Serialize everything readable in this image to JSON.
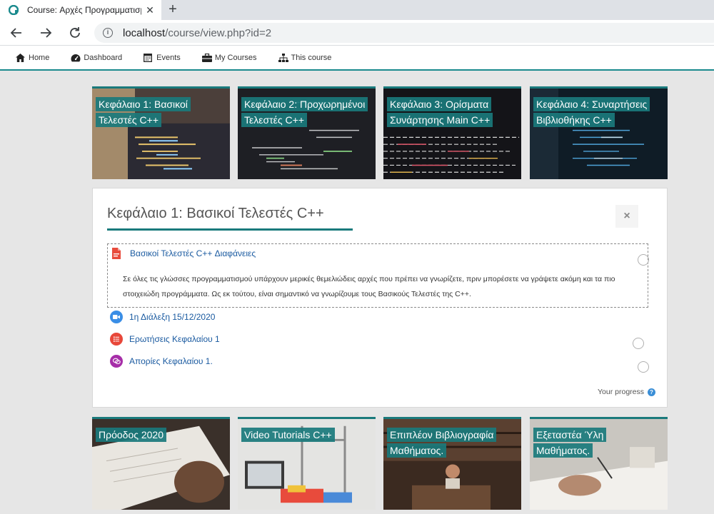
{
  "browser": {
    "tab_title": "Course: Αρχές Προγραμματισμο",
    "new_tab": "+",
    "url_host": "localhost",
    "url_path": "/course/view.php?id=2"
  },
  "navbar": {
    "items": [
      {
        "label": "Home",
        "icon": "home-icon"
      },
      {
        "label": "Dashboard",
        "icon": "dashboard-icon"
      },
      {
        "label": "Events",
        "icon": "calendar-icon"
      },
      {
        "label": "My Courses",
        "icon": "briefcase-icon"
      },
      {
        "label": "This course",
        "icon": "sitemap-icon"
      }
    ]
  },
  "tiles_top": [
    {
      "title": "Κεφάλαιο 1: Βασικοί Τελεστές C++"
    },
    {
      "title": "Κεφάλαιο 2: Προχωρημένοι Τελεστές C++"
    },
    {
      "title": "Κεφάλαιο 3: Ορίσματα Συνάρτησης Main C++"
    },
    {
      "title": "Κεφάλαιο 4: Συναρτήσεις Βιβλιοθήκης C++"
    }
  ],
  "section": {
    "title": "Κεφάλαιο 1: Βασικοί Τελεστές C++",
    "close_label": "×",
    "activities": [
      {
        "label": "Βασικοί Τελεστές C++ Διαφάνειες",
        "icon": "pdf-icon"
      },
      {
        "label": "1η Διάλεξη 15/12/2020",
        "icon": "video-icon"
      },
      {
        "label": "Ερωτήσεις Κεφαλαίου 1",
        "icon": "quiz-icon"
      },
      {
        "label": "Απορίες Κεφαλαίου 1.",
        "icon": "forum-icon"
      }
    ],
    "description": "Σε όλες τις γλώσσες προγραμματισμού υπάρχουν μερικές θεμελιώδεις αρχές που πρέπει να γνωρίζετε, πριν μπορέσετε να γράψετε ακόμη και τα πιο στοιχειώδη προγράμματα. Ως εκ τούτου, είναι σημαντικό να γνωρίζουμε τους Βασικούς Τελεστές της C++.",
    "progress_label": "Your progress",
    "help": "?"
  },
  "tiles_bottom": [
    {
      "title": "Πρόοδος 2020"
    },
    {
      "title": "Video Tutorials C++"
    },
    {
      "title": "Επιπλέον Βιβλιογραφία Μαθήματος."
    },
    {
      "title": "Εξεταστέα Ύλη Μαθήματος."
    }
  ],
  "colors": {
    "accent": "#1a7a7c",
    "link": "#1a5aa0"
  }
}
